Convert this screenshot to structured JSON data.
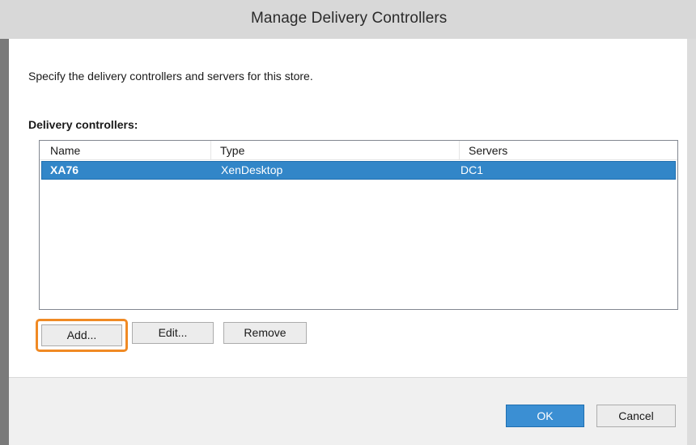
{
  "window": {
    "title": "Manage Delivery Controllers"
  },
  "content": {
    "description": "Specify the delivery controllers and servers for this store.",
    "section_label": "Delivery controllers:"
  },
  "list": {
    "columns": [
      "Name",
      "Type",
      "Servers"
    ],
    "rows": [
      {
        "name": "XA76",
        "type": "XenDesktop",
        "servers": "DC1",
        "selected": true
      }
    ]
  },
  "list_buttons": {
    "add": "Add...",
    "edit": "Edit...",
    "remove": "Remove"
  },
  "dialog_buttons": {
    "ok": "OK",
    "cancel": "Cancel"
  },
  "colors": {
    "selection": "#3286c8",
    "focus_ring": "#f08a24",
    "primary_button": "#3b8fd3"
  }
}
